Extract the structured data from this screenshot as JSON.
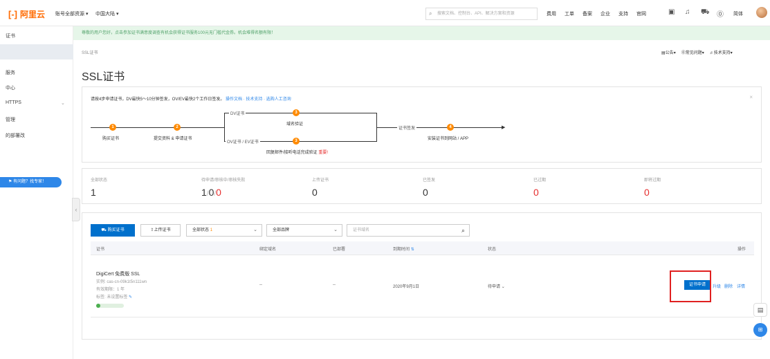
{
  "topbar": {
    "logo_bracket": "[-]",
    "logo_text": "阿里云",
    "menu_resources": "账号全部资源",
    "menu_region": "中国大陆",
    "search_placeholder": "搜索文档、控制台、API、解决方案和资源",
    "links": [
      "费用",
      "工单",
      "备案",
      "企业",
      "支持",
      "官网"
    ],
    "lang": "简体"
  },
  "sidebar": {
    "items": [
      "证书",
      "",
      "服务",
      "中心",
      "HTTPS",
      "管理",
      "的部署改"
    ],
    "help_label": "有问题？找专家！"
  },
  "notice": "尊敬的用户您好，点击参加证书满意度调查有机会获得证书服务100元无门槛代金券。机会难得名额有限！",
  "page": {
    "breadcrumb": "SSL证书",
    "title": "SSL证书",
    "help_links": [
      "公告",
      "常见问题",
      "技术支持"
    ]
  },
  "steps": {
    "intro": "请按4步申请证书，DV最快5～10分钟签发，OV/EV最快2个工作日签发。",
    "intro_links": "操作文档 · 技术支持 · 选购人工咨询",
    "step1": "购买证书",
    "step2": "提交资料 & 申请证书",
    "branch_dv": "DV证书",
    "branch_ov": "OV证书 / EV证书",
    "step3_dv": "域名验证",
    "step3_ov": "回复邮件/接听电话完成验证",
    "step3_ov_important": "重要!",
    "issued": "证书签发",
    "step4": "安装证书到网站 / APP",
    "nums": [
      "1",
      "2",
      "3",
      "3",
      "4"
    ]
  },
  "stats": [
    {
      "label": "全部状态",
      "value": "1"
    },
    {
      "label": "待申请/审核中/审核失败",
      "value_a": "1",
      "value_b": "0",
      "value_c": "0"
    },
    {
      "label": "上传证书",
      "value": "0"
    },
    {
      "label": "已签发",
      "value": "0"
    },
    {
      "label": "已过期",
      "value": "0"
    },
    {
      "label": "即将过期",
      "value": "0"
    }
  ],
  "toolbar": {
    "buy": "购买证书",
    "upload": "上传证书",
    "status_filter": "全部状态",
    "status_count": "1",
    "brand_filter": "全部品牌",
    "search_placeholder": "证书域名"
  },
  "table": {
    "headers": [
      "证书",
      "绑定域名",
      "已部署",
      "到期时间",
      "状态",
      "操作"
    ],
    "row": {
      "name": "DigiCert 免费版 SSL",
      "instance": "实例: cas-cn-09k1t5n111wn",
      "validity": "有效期限：1 年",
      "tags": "标签: 未设置标签",
      "domain": "--",
      "deployed": "--",
      "expire": "2020年9月1日",
      "status": "待申请",
      "btn_apply": "证书申请",
      "link_upgrade": "升级",
      "link_delete": "删除",
      "link_detail": "详情"
    }
  },
  "colors": {
    "accent": "#0070cc",
    "brand": "#ff6a00",
    "danger": "#e62e2e",
    "notice_bg": "#e6f6e9"
  }
}
